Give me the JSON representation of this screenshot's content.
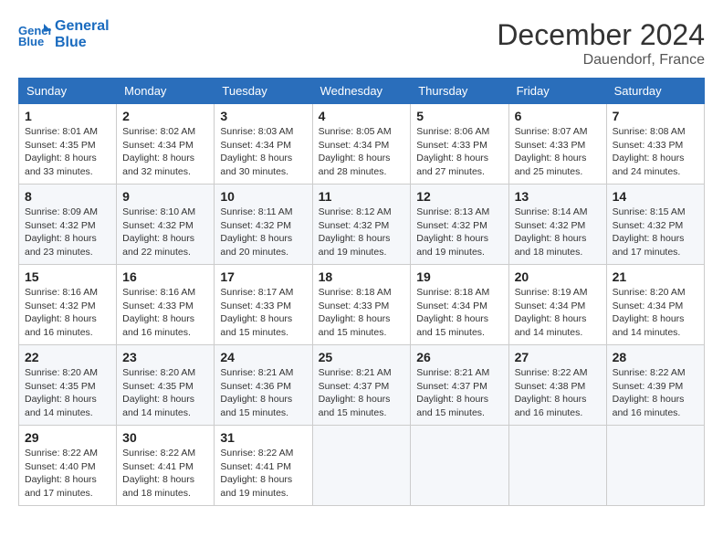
{
  "header": {
    "logo_line1": "General",
    "logo_line2": "Blue",
    "month": "December 2024",
    "location": "Dauendorf, France"
  },
  "weekdays": [
    "Sunday",
    "Monday",
    "Tuesday",
    "Wednesday",
    "Thursday",
    "Friday",
    "Saturday"
  ],
  "weeks": [
    [
      {
        "day": "1",
        "sunrise": "8:01 AM",
        "sunset": "4:35 PM",
        "daylight": "8 hours and 33 minutes."
      },
      {
        "day": "2",
        "sunrise": "8:02 AM",
        "sunset": "4:34 PM",
        "daylight": "8 hours and 32 minutes."
      },
      {
        "day": "3",
        "sunrise": "8:03 AM",
        "sunset": "4:34 PM",
        "daylight": "8 hours and 30 minutes."
      },
      {
        "day": "4",
        "sunrise": "8:05 AM",
        "sunset": "4:34 PM",
        "daylight": "8 hours and 28 minutes."
      },
      {
        "day": "5",
        "sunrise": "8:06 AM",
        "sunset": "4:33 PM",
        "daylight": "8 hours and 27 minutes."
      },
      {
        "day": "6",
        "sunrise": "8:07 AM",
        "sunset": "4:33 PM",
        "daylight": "8 hours and 25 minutes."
      },
      {
        "day": "7",
        "sunrise": "8:08 AM",
        "sunset": "4:33 PM",
        "daylight": "8 hours and 24 minutes."
      }
    ],
    [
      {
        "day": "8",
        "sunrise": "8:09 AM",
        "sunset": "4:32 PM",
        "daylight": "8 hours and 23 minutes."
      },
      {
        "day": "9",
        "sunrise": "8:10 AM",
        "sunset": "4:32 PM",
        "daylight": "8 hours and 22 minutes."
      },
      {
        "day": "10",
        "sunrise": "8:11 AM",
        "sunset": "4:32 PM",
        "daylight": "8 hours and 20 minutes."
      },
      {
        "day": "11",
        "sunrise": "8:12 AM",
        "sunset": "4:32 PM",
        "daylight": "8 hours and 19 minutes."
      },
      {
        "day": "12",
        "sunrise": "8:13 AM",
        "sunset": "4:32 PM",
        "daylight": "8 hours and 19 minutes."
      },
      {
        "day": "13",
        "sunrise": "8:14 AM",
        "sunset": "4:32 PM",
        "daylight": "8 hours and 18 minutes."
      },
      {
        "day": "14",
        "sunrise": "8:15 AM",
        "sunset": "4:32 PM",
        "daylight": "8 hours and 17 minutes."
      }
    ],
    [
      {
        "day": "15",
        "sunrise": "8:16 AM",
        "sunset": "4:32 PM",
        "daylight": "8 hours and 16 minutes."
      },
      {
        "day": "16",
        "sunrise": "8:16 AM",
        "sunset": "4:33 PM",
        "daylight": "8 hours and 16 minutes."
      },
      {
        "day": "17",
        "sunrise": "8:17 AM",
        "sunset": "4:33 PM",
        "daylight": "8 hours and 15 minutes."
      },
      {
        "day": "18",
        "sunrise": "8:18 AM",
        "sunset": "4:33 PM",
        "daylight": "8 hours and 15 minutes."
      },
      {
        "day": "19",
        "sunrise": "8:18 AM",
        "sunset": "4:34 PM",
        "daylight": "8 hours and 15 minutes."
      },
      {
        "day": "20",
        "sunrise": "8:19 AM",
        "sunset": "4:34 PM",
        "daylight": "8 hours and 14 minutes."
      },
      {
        "day": "21",
        "sunrise": "8:20 AM",
        "sunset": "4:34 PM",
        "daylight": "8 hours and 14 minutes."
      }
    ],
    [
      {
        "day": "22",
        "sunrise": "8:20 AM",
        "sunset": "4:35 PM",
        "daylight": "8 hours and 14 minutes."
      },
      {
        "day": "23",
        "sunrise": "8:20 AM",
        "sunset": "4:35 PM",
        "daylight": "8 hours and 14 minutes."
      },
      {
        "day": "24",
        "sunrise": "8:21 AM",
        "sunset": "4:36 PM",
        "daylight": "8 hours and 15 minutes."
      },
      {
        "day": "25",
        "sunrise": "8:21 AM",
        "sunset": "4:37 PM",
        "daylight": "8 hours and 15 minutes."
      },
      {
        "day": "26",
        "sunrise": "8:21 AM",
        "sunset": "4:37 PM",
        "daylight": "8 hours and 15 minutes."
      },
      {
        "day": "27",
        "sunrise": "8:22 AM",
        "sunset": "4:38 PM",
        "daylight": "8 hours and 16 minutes."
      },
      {
        "day": "28",
        "sunrise": "8:22 AM",
        "sunset": "4:39 PM",
        "daylight": "8 hours and 16 minutes."
      }
    ],
    [
      {
        "day": "29",
        "sunrise": "8:22 AM",
        "sunset": "4:40 PM",
        "daylight": "8 hours and 17 minutes."
      },
      {
        "day": "30",
        "sunrise": "8:22 AM",
        "sunset": "4:41 PM",
        "daylight": "8 hours and 18 minutes."
      },
      {
        "day": "31",
        "sunrise": "8:22 AM",
        "sunset": "4:41 PM",
        "daylight": "8 hours and 19 minutes."
      },
      null,
      null,
      null,
      null
    ]
  ]
}
